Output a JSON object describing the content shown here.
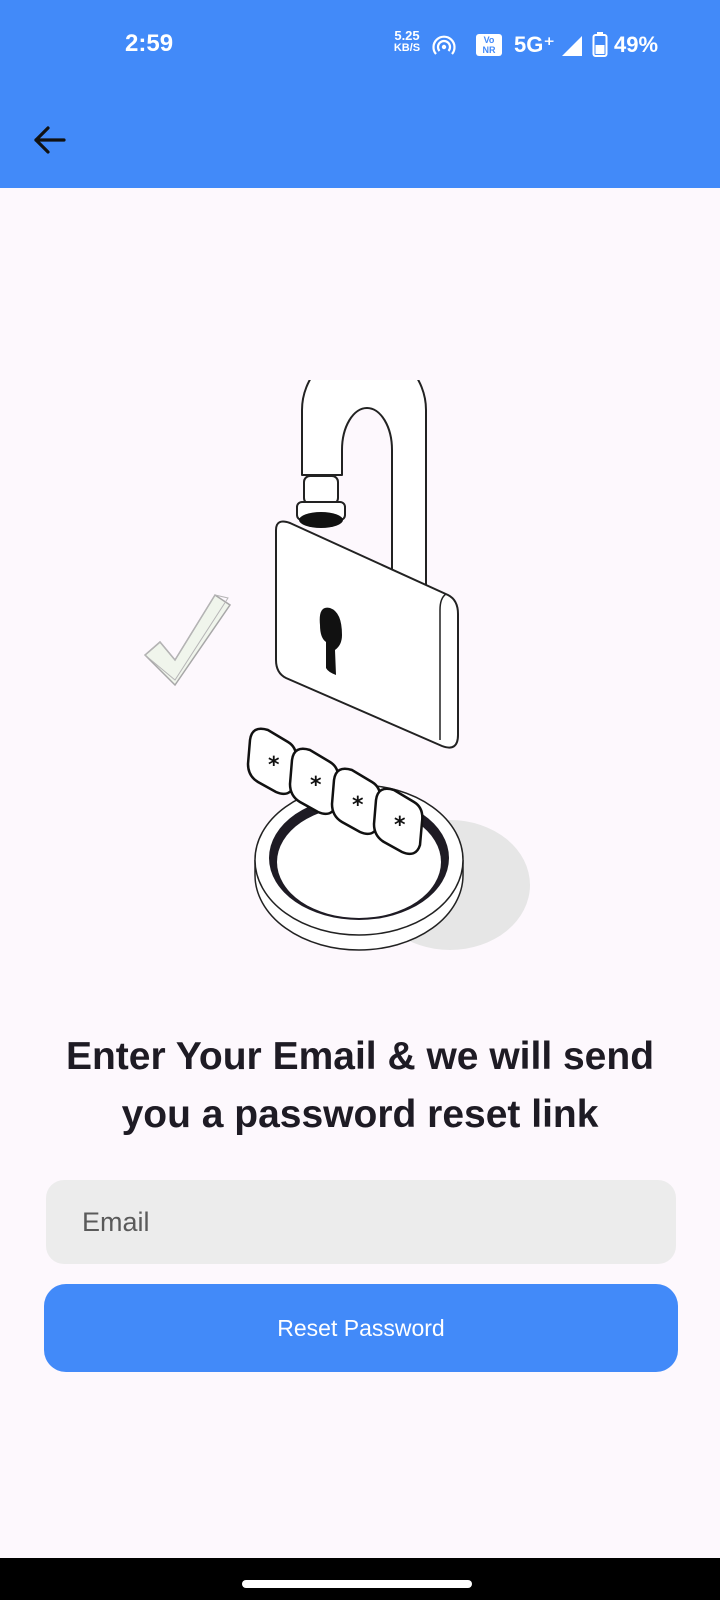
{
  "status_bar": {
    "time": "2:59",
    "net_speed_value": "5.25",
    "net_speed_unit": "KB/S",
    "vonr_badge_top": "Vo",
    "vonr_badge_bottom": "NR",
    "network": "5G⁺",
    "battery": "49%"
  },
  "app_bar": {
    "back_icon": "arrow-left-icon",
    "color": "#428af9"
  },
  "illustration": {
    "icon": "padlock-password-illustration",
    "password_chars": [
      "*",
      "*",
      "*",
      "*"
    ]
  },
  "main": {
    "headline": "Enter Your Email & we will send you a password reset link",
    "email_placeholder": "Email",
    "email_value": "",
    "reset_button_label": "Reset Password",
    "accent_color": "#428af9"
  }
}
